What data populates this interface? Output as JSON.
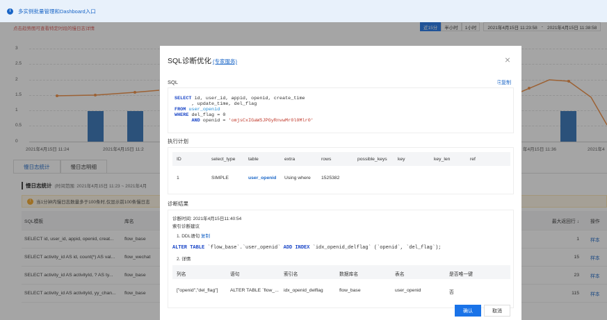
{
  "banner": {
    "text": "多实例批量管理和Dashboard入口",
    "info_icon": "i"
  },
  "page": {
    "hint": "点击趋势图可查看特定时段的慢日志详情",
    "time_buttons": [
      "近15分",
      "半小时",
      "1小时"
    ],
    "active_time_button": "近15分",
    "time_range": {
      "start": "2021年4月15日 11:23:58",
      "sep": "-",
      "end": "2021年4月15日 11:38:58"
    },
    "chart": {
      "y_ticks": [
        "3",
        "2.5",
        "2",
        "1.5",
        "1",
        "0.5",
        "0"
      ],
      "x_labels": [
        "2021年4月15日 11:24",
        "2021年4月15日 11:2",
        "年4月15日 11:36",
        "2021年4"
      ]
    },
    "tabs": [
      "慢日志统计",
      "慢日志明细"
    ],
    "section_title": "慢日志统计",
    "section_sub": "(时间范围: 2021年4月15日 11:23 ~ 2021年4月",
    "warning": "当1分钟内慢日志数量多于100条时,仅显示前100条慢日志",
    "table": {
      "headers": {
        "template": "SQL模板",
        "db": "库名",
        "max_rows": "最大返回行 ↓",
        "ops": "操作"
      },
      "rows": [
        {
          "template": "SELECT id, user_id, appid, openid, creat...",
          "db": "flow_base",
          "max_rows": "1",
          "op": "样本"
        },
        {
          "template": "SELECT activity_id AS id, count(*) AS val...",
          "db": "flow_wechat",
          "max_rows": "15",
          "op": "样本"
        },
        {
          "template": "SELECT activity_id AS activityId, ? AS ty...",
          "db": "flow_base",
          "max_rows": "23",
          "op": "样本"
        },
        {
          "template": "SELECT activity_id AS activityId, yy_chan...",
          "db": "flow_base",
          "max_rows": "115",
          "op": "样本"
        }
      ]
    }
  },
  "modal": {
    "title": "SQL诊断优化",
    "expert_link": "(专家服务)",
    "close": "×",
    "sql_label": "SQL",
    "copy": "复制",
    "sql": {
      "l1a": "SELECT",
      "l1b": " id, user_id, appid, openid, create_time",
      "l2": "      , update_time, del_flag",
      "l3a": "FROM",
      "l3b": "user_openid",
      "l4a": "WHERE",
      "l4b": " del_flag = 0",
      "l5a": "      AND",
      "l5b": " openid = ",
      "l5c": "'omjsCxIGaWSJPGyRnvwMr0l0Mlr0'"
    },
    "plan_label": "执行计划",
    "plan": {
      "headers": [
        "ID",
        "select_type",
        "table",
        "extra",
        "rows",
        "possible_keys",
        "key",
        "key_len",
        "ref"
      ],
      "row": [
        "1",
        "SIMPLE",
        "user_openid",
        "Using where",
        "1525382",
        "",
        "",
        "",
        ""
      ]
    },
    "diag_label": "诊断结果",
    "diag": {
      "time": "诊断时间: 2021年4月15日11:40:54",
      "suggest": "索引诊断建议",
      "ddl_prefix": "1. DDL语句",
      "ddl_copy": "复制",
      "alter_a": "ALTER TABLE",
      "alter_b": " `flow_base`.`user_openid` ",
      "alter_c": "ADD INDEX",
      "alter_d": " `idx_openid_delflag` (`openid`, `del_flag`);",
      "detail": "2. 详情",
      "headers": [
        "列名",
        "语句",
        "索引名",
        "数据库名",
        "表名",
        "是否唯一键"
      ],
      "row": [
        "[\"openid\",\"del_flag\"]",
        "ALTER TABLE `flow_...",
        "idx_openid_delflag",
        "flow_base",
        "user_openid",
        "否"
      ]
    },
    "ok": "确认",
    "cancel": "取消"
  }
}
